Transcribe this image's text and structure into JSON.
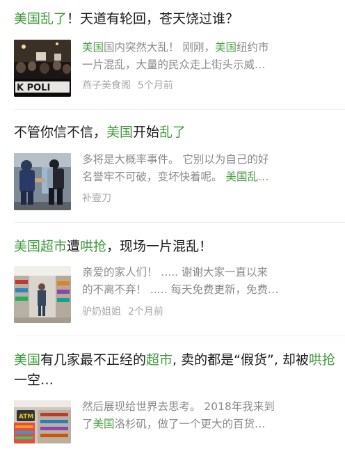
{
  "articles": [
    {
      "title_parts": [
        {
          "text": "美国乱了",
          "hl": true
        },
        {
          "text": "！天道有轮回，苍天饶过谁？",
          "hl": false
        }
      ],
      "thumb_icon": "protest-crowd-thumbnail",
      "thumb_text": "K POLI",
      "snippet_lines": [
        [
          {
            "text": "美国",
            "hl": true
          },
          {
            "text": "国内突然大乱！ 刚刚，",
            "hl": false
          },
          {
            "text": "美国",
            "hl": true
          },
          {
            "text": "纽约市",
            "hl": false
          }
        ],
        [
          {
            "text": "一片混乱，大量的民众走上街头示威…",
            "hl": false
          }
        ]
      ],
      "source": "燕子美食阁",
      "time": "5个月前"
    },
    {
      "title_parts": [
        {
          "text": "不管你信不信，",
          "hl": false
        },
        {
          "text": "美国",
          "hl": true
        },
        {
          "text": "开始",
          "hl": false
        },
        {
          "text": "乱了",
          "hl": true
        }
      ],
      "thumb_icon": "riot-police-thumbnail",
      "snippet_lines": [
        [
          {
            "text": "多将是大概率事件。 它别以为自己的好",
            "hl": false
          }
        ],
        [
          {
            "text": "名誉牢不可破，变坏快着呢。 ",
            "hl": false
          },
          {
            "text": "美国乱",
            "hl": true
          },
          {
            "text": "…",
            "hl": false
          }
        ]
      ],
      "source": "补壹刀",
      "time": ""
    },
    {
      "title_parts": [
        {
          "text": "美国超市",
          "hl": true
        },
        {
          "text": "遭",
          "hl": false
        },
        {
          "text": "哄抢",
          "hl": true
        },
        {
          "text": "，现场一片混乱！",
          "hl": false
        }
      ],
      "thumb_icon": "supermarket-aisle-thumbnail",
      "snippet_lines": [
        [
          {
            "text": "亲爱的家人们！ ..... 谢谢大家一直以来",
            "hl": false
          }
        ],
        [
          {
            "text": "的不离不弃！ ..... 每天免费更新，免费…",
            "hl": false
          }
        ]
      ],
      "source": "驴奶姐姐",
      "time": "2个月前"
    },
    {
      "title_parts": [
        {
          "text": "美国",
          "hl": true
        },
        {
          "text": "有几家最不正经的",
          "hl": false
        },
        {
          "text": "超市",
          "hl": true
        },
        {
          "text": ", 卖的都是“假货”, 却被",
          "hl": false
        },
        {
          "text": "哄抢",
          "hl": true
        },
        {
          "text": "一空…",
          "hl": false
        }
      ],
      "thumb_icon": "store-atm-thumbnail",
      "thumb_text": "ATM",
      "snippet_lines": [
        [
          {
            "text": "然后展现给世界去思考。 2018年我来到",
            "hl": false
          }
        ],
        [
          {
            "text": "了",
            "hl": false
          },
          {
            "text": "美国",
            "hl": true
          },
          {
            "text": "洛杉矶，做了一个更大的百货…",
            "hl": false
          }
        ]
      ],
      "source": "",
      "time": ""
    }
  ]
}
